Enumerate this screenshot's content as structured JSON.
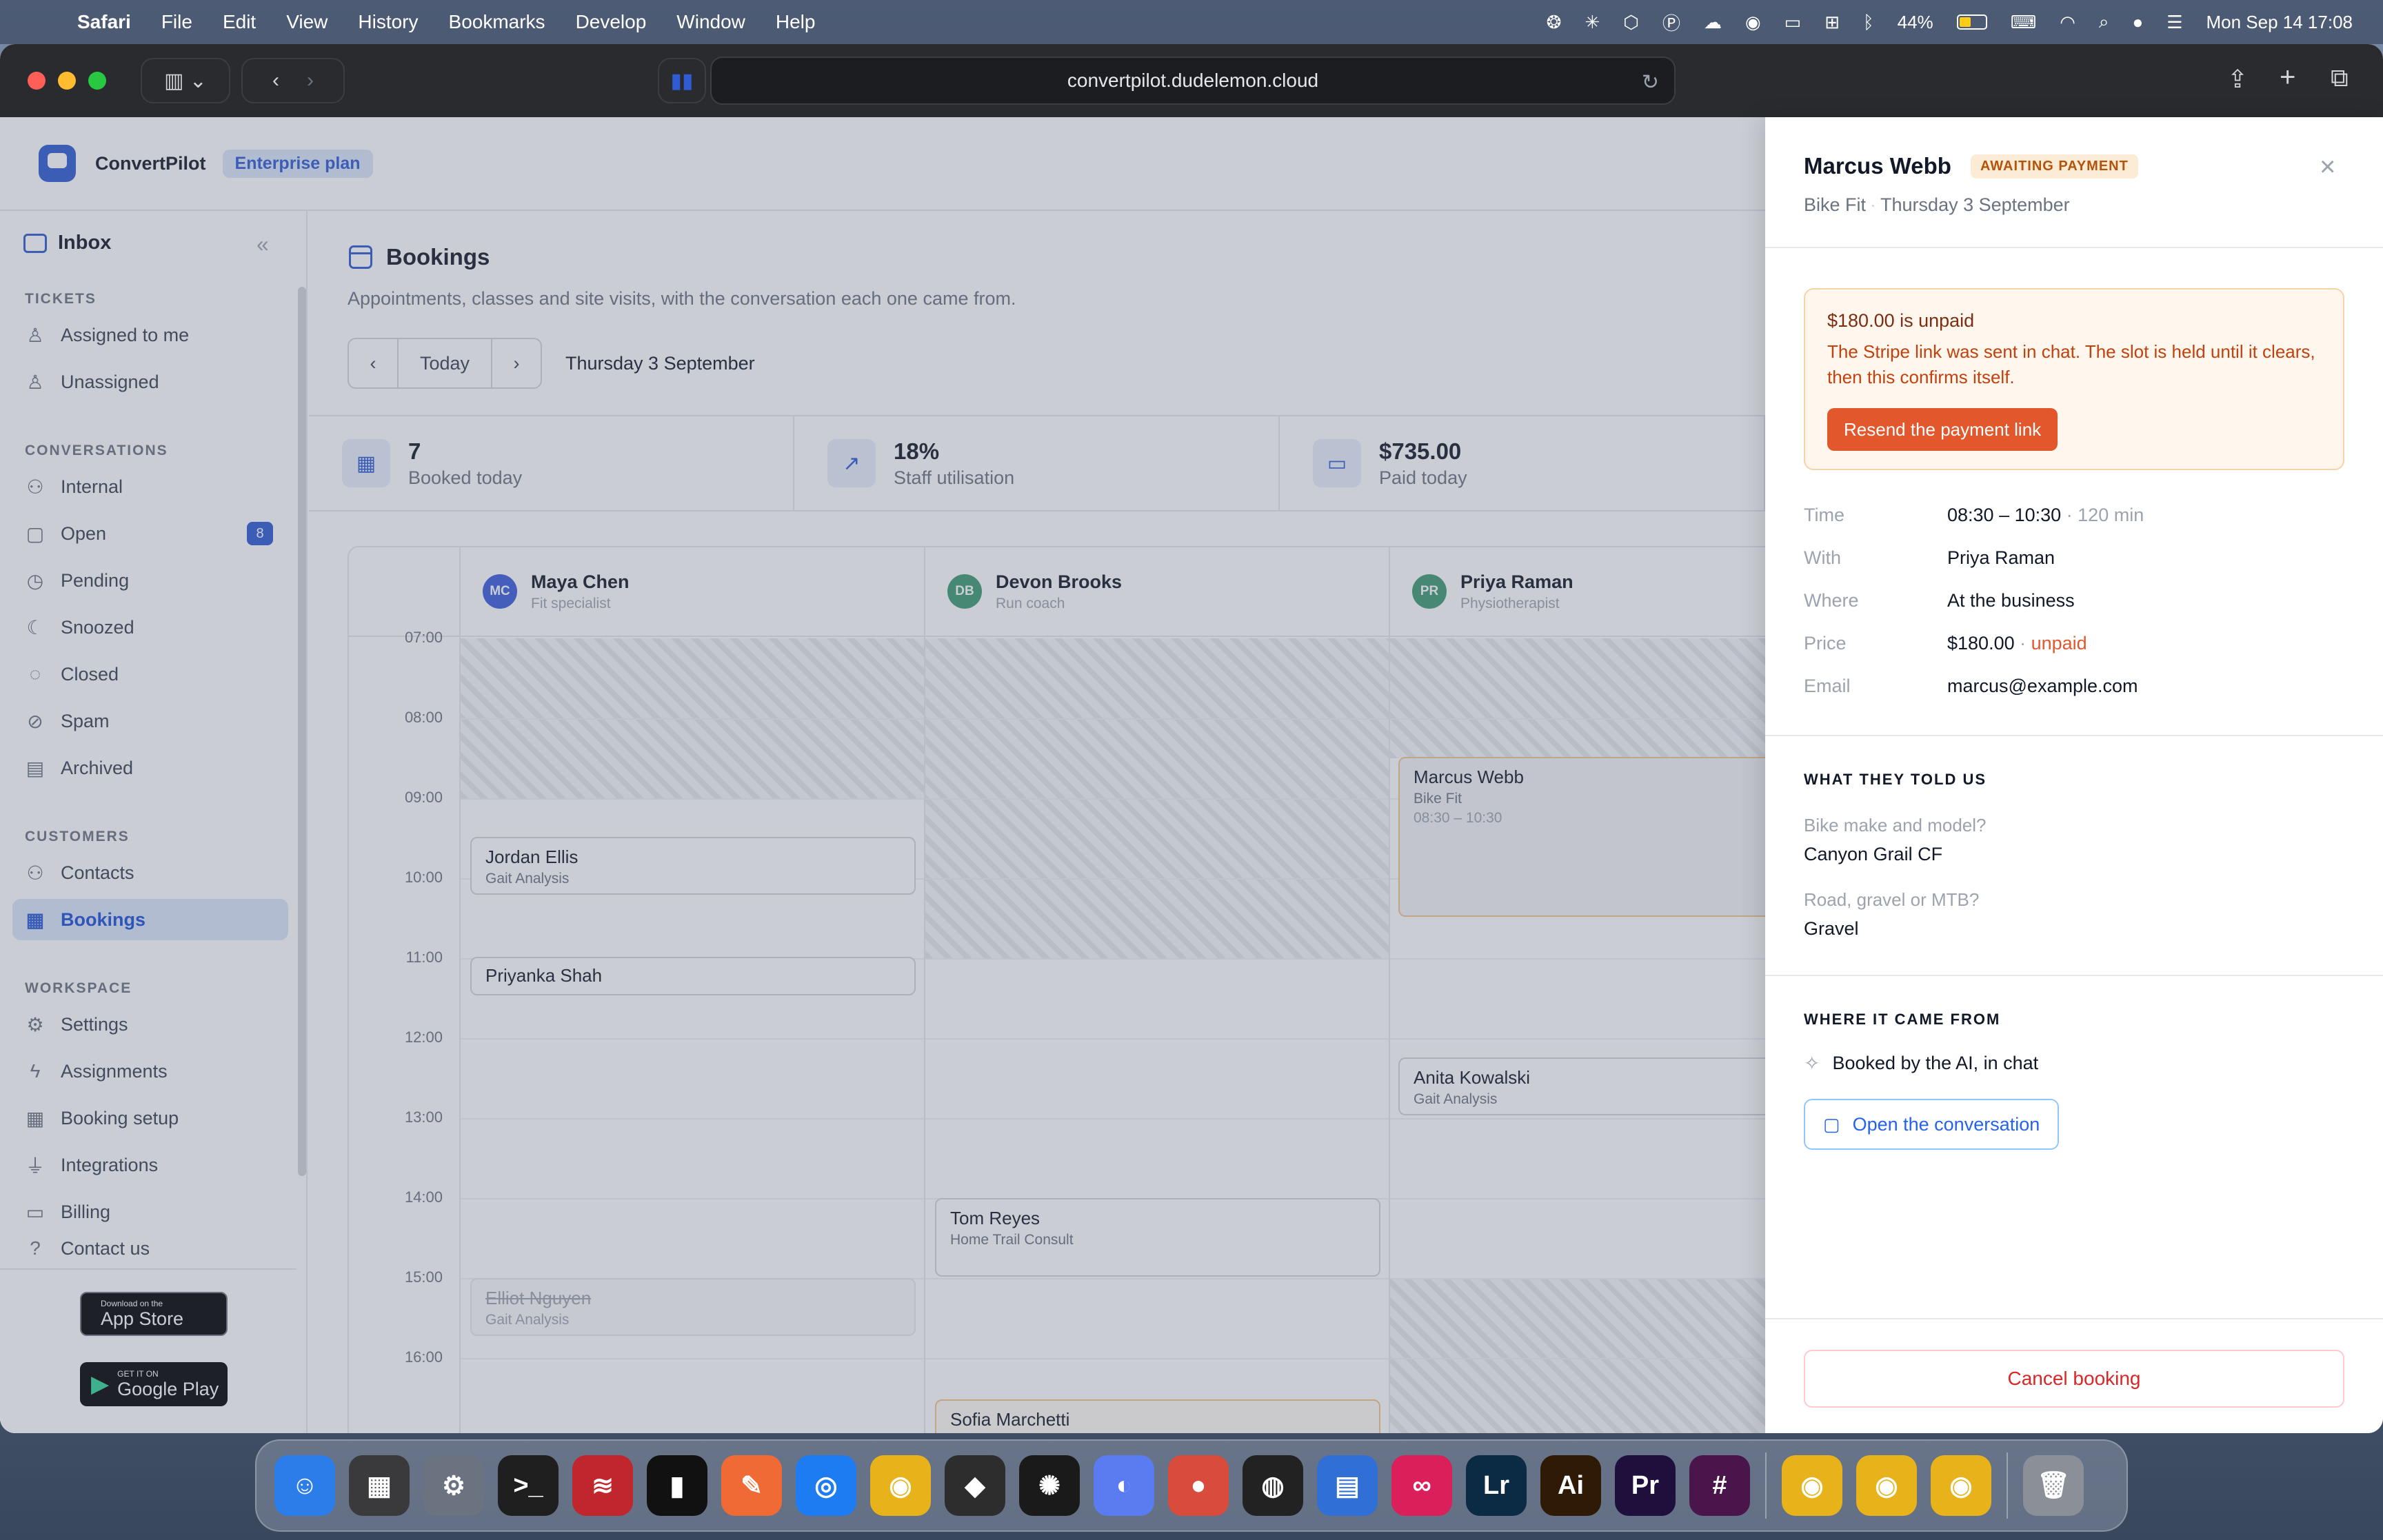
{
  "menubar": {
    "app": "Safari",
    "items": [
      "File",
      "Edit",
      "View",
      "History",
      "Bookmarks",
      "Develop",
      "Window",
      "Help"
    ],
    "battery": "44%",
    "clock": "Mon Sep 14  17:08"
  },
  "browser": {
    "url": "convertpilot.dudelemon.cloud"
  },
  "app": {
    "brand": "ConvertPilot",
    "plan": "Enterprise plan"
  },
  "sidebar": {
    "inbox": "Inbox",
    "sections": {
      "tickets": "TICKETS",
      "conversations": "CONVERSATIONS",
      "customers": "CUSTOMERS",
      "workspace": "WORKSPACE"
    },
    "tickets": [
      {
        "label": "Assigned to me",
        "icon": "user-icon"
      },
      {
        "label": "Unassigned",
        "icon": "user-plus-icon"
      }
    ],
    "conversations": [
      {
        "label": "Internal",
        "icon": "users-icon"
      },
      {
        "label": "Open",
        "icon": "chat-icon",
        "badge": "8"
      },
      {
        "label": "Pending",
        "icon": "clock-icon"
      },
      {
        "label": "Snoozed",
        "icon": "moon-icon"
      },
      {
        "label": "Closed",
        "icon": "check-circle-icon"
      },
      {
        "label": "Spam",
        "icon": "ban-icon"
      },
      {
        "label": "Archived",
        "icon": "archive-icon"
      }
    ],
    "customers": [
      {
        "label": "Contacts",
        "icon": "users-icon"
      },
      {
        "label": "Bookings",
        "icon": "calendar-icon"
      }
    ],
    "workspace": [
      {
        "label": "Settings",
        "icon": "gear-icon"
      },
      {
        "label": "Assignments",
        "icon": "bolt-icon"
      },
      {
        "label": "Booking setup",
        "icon": "calendar-cog-icon"
      },
      {
        "label": "Integrations",
        "icon": "plug-icon"
      },
      {
        "label": "Billing",
        "icon": "card-icon"
      },
      {
        "label": "Contact us",
        "icon": "help-icon"
      }
    ],
    "appstore": {
      "small": "Download on the",
      "big": "App Store"
    },
    "googleplay": {
      "small": "GET IT ON",
      "big": "Google Play"
    }
  },
  "main": {
    "title": "Bookings",
    "subtitle": "Appointments, classes and site visits, with the conversation each one came from.",
    "today_label": "Today",
    "current_date": "Thursday 3 September",
    "stats": [
      {
        "value": "7",
        "label": "Booked today",
        "icon": "calendar-icon"
      },
      {
        "value": "18%",
        "label": "Staff utilisation",
        "icon": "trend-up-icon"
      },
      {
        "value": "$735.00",
        "label": "Paid today",
        "icon": "card-icon"
      }
    ],
    "staff": [
      {
        "initials": "MC",
        "name": "Maya Chen",
        "role": "Fit specialist",
        "color": "#3b5bdb"
      },
      {
        "initials": "DB",
        "name": "Devon Brooks",
        "role": "Run coach",
        "color": "#3d9a70"
      },
      {
        "initials": "PR",
        "name": "Priya Raman",
        "role": "Physiotherapist",
        "color": "#3d9a70"
      }
    ],
    "times": [
      "07:00",
      "08:00",
      "09:00",
      "10:00",
      "11:00",
      "12:00",
      "13:00",
      "14:00",
      "15:00",
      "16:00"
    ],
    "events": {
      "jordan": {
        "name": "Jordan Ellis",
        "service": "Gait Analysis"
      },
      "priyanka": {
        "name": "Priyanka Shah"
      },
      "elliot": {
        "name": "Elliot Nguyen",
        "service": "Gait Analysis"
      },
      "tom": {
        "name": "Tom Reyes",
        "service": "Home Trail Consult"
      },
      "sofia": {
        "name": "Sofia Marchetti"
      },
      "marcus": {
        "name": "Marcus Webb",
        "service": "Bike Fit",
        "time": "08:30 – 10:30"
      },
      "anita": {
        "name": "Anita Kowalski",
        "service": "Gait Analysis"
      }
    }
  },
  "panel": {
    "name": "Marcus Webb",
    "status": "AWAITING PAYMENT",
    "service": "Bike Fit",
    "date": "Thursday 3 September",
    "alert": {
      "heading": "$180.00 is unpaid",
      "body": "The Stripe link was sent in chat. The slot is held until it clears, then this confirms itself.",
      "button": "Resend the payment link"
    },
    "details": {
      "time_label": "Time",
      "time": "08:30 – 10:30",
      "duration": "120 min",
      "with_label": "With",
      "with": "Priya Raman",
      "where_label": "Where",
      "where": "At the business",
      "price_label": "Price",
      "price": "$180.00",
      "price_status": "unpaid",
      "email_label": "Email",
      "email": "marcus@example.com"
    },
    "told_heading": "WHAT THEY TOLD US",
    "answers": [
      {
        "q": "Bike make and model?",
        "a": "Canyon Grail CF"
      },
      {
        "q": "Road, gravel or MTB?",
        "a": "Gravel"
      }
    ],
    "source_heading": "WHERE IT CAME FROM",
    "source": "Booked by the AI, in chat",
    "open_conversation": "Open the conversation",
    "cancel": "Cancel booking"
  },
  "dock": {
    "apps": [
      {
        "name": "finder",
        "glyph": "☺",
        "color": "#2b7de9"
      },
      {
        "name": "launchpad",
        "glyph": "▦",
        "color": "#3a3a3c"
      },
      {
        "name": "system-settings",
        "glyph": "⚙",
        "color": "#6b7280"
      },
      {
        "name": "terminal",
        "glyph": ">_",
        "color": "#1f1f1f"
      },
      {
        "name": "app-red",
        "glyph": "≋",
        "color": "#c0262d"
      },
      {
        "name": "app-dark",
        "glyph": "▮",
        "color": "#111111"
      },
      {
        "name": "app-orange",
        "glyph": "✎",
        "color": "#f06a35"
      },
      {
        "name": "safari",
        "glyph": "◎",
        "color": "#1e7cf2"
      },
      {
        "name": "chrome",
        "glyph": "◉",
        "color": "#e8b21a"
      },
      {
        "name": "app-cube",
        "glyph": "◆",
        "color": "#2d2d2d"
      },
      {
        "name": "app-spark",
        "glyph": "✺",
        "color": "#1a1a1a"
      },
      {
        "name": "app-blue",
        "glyph": "◐",
        "color": "#5b7cf0"
      },
      {
        "name": "app-dots",
        "glyph": "●",
        "color": "#d94b3b"
      },
      {
        "name": "app-sphere",
        "glyph": "◍",
        "color": "#222222"
      },
      {
        "name": "app-files",
        "glyph": "▤",
        "color": "#2f6fd6"
      },
      {
        "name": "creative-cloud",
        "glyph": "∞",
        "color": "#da1f5b"
      },
      {
        "name": "lightroom",
        "glyph": "Lr",
        "color": "#0b2a44"
      },
      {
        "name": "illustrator",
        "glyph": "Ai",
        "color": "#2e1a05"
      },
      {
        "name": "premiere",
        "glyph": "Pr",
        "color": "#1f0f3d"
      },
      {
        "name": "slack",
        "glyph": "#",
        "color": "#4a154b"
      }
    ],
    "recent": [
      {
        "name": "chrome-1",
        "glyph": "◉",
        "color": "#e8b21a"
      },
      {
        "name": "chrome-2",
        "glyph": "◉",
        "color": "#e8b21a"
      },
      {
        "name": "chrome-3",
        "glyph": "◉",
        "color": "#e8b21a"
      }
    ],
    "trash": {
      "name": "trash",
      "glyph": "🗑",
      "color": "#8a8f98"
    }
  }
}
